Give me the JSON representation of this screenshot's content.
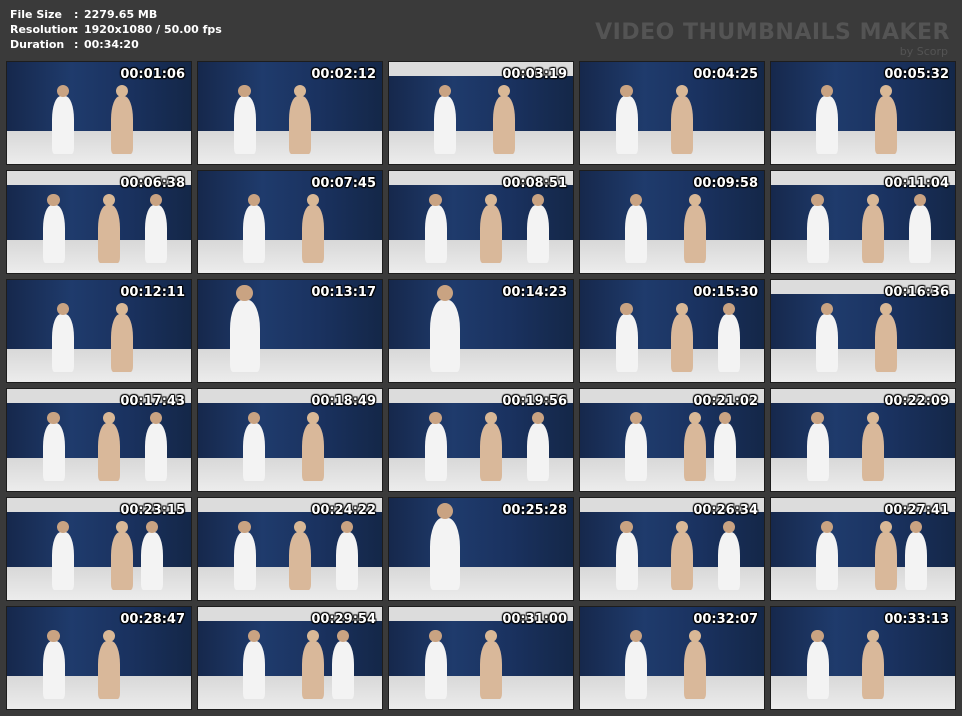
{
  "info": {
    "file_size_label": "File Size",
    "file_size_value": "2279.65 MB",
    "resolution_label": "Resolution",
    "resolution_value": "1920x1080 / 50.00 fps",
    "duration_label": "Duration",
    "duration_value": "00:34:20",
    "separator": ":"
  },
  "brand": {
    "title": "VIDEO THUMBNAILS MAKER",
    "subtitle": "by Scorp"
  },
  "thumbnails": [
    {
      "time": "00:01:06",
      "ceiling": false,
      "people": 2
    },
    {
      "time": "00:02:12",
      "ceiling": false,
      "people": 2
    },
    {
      "time": "00:03:19",
      "ceiling": true,
      "people": 2
    },
    {
      "time": "00:04:25",
      "ceiling": false,
      "people": 2
    },
    {
      "time": "00:05:32",
      "ceiling": false,
      "people": 2
    },
    {
      "time": "00:06:38",
      "ceiling": true,
      "people": 3
    },
    {
      "time": "00:07:45",
      "ceiling": false,
      "people": 2
    },
    {
      "time": "00:08:51",
      "ceiling": true,
      "people": 3
    },
    {
      "time": "00:09:58",
      "ceiling": false,
      "people": 2
    },
    {
      "time": "00:11:04",
      "ceiling": true,
      "people": 3
    },
    {
      "time": "00:12:11",
      "ceiling": false,
      "people": 2
    },
    {
      "time": "00:13:17",
      "ceiling": false,
      "people": 1
    },
    {
      "time": "00:14:23",
      "ceiling": false,
      "people": 1
    },
    {
      "time": "00:15:30",
      "ceiling": false,
      "people": 3
    },
    {
      "time": "00:16:36",
      "ceiling": true,
      "people": 2
    },
    {
      "time": "00:17:43",
      "ceiling": true,
      "people": 3
    },
    {
      "time": "00:18:49",
      "ceiling": true,
      "people": 2
    },
    {
      "time": "00:19:56",
      "ceiling": true,
      "people": 3
    },
    {
      "time": "00:21:02",
      "ceiling": true,
      "people": 3
    },
    {
      "time": "00:22:09",
      "ceiling": true,
      "people": 2
    },
    {
      "time": "00:23:15",
      "ceiling": true,
      "people": 3
    },
    {
      "time": "00:24:22",
      "ceiling": true,
      "people": 3
    },
    {
      "time": "00:25:28",
      "ceiling": false,
      "people": 1
    },
    {
      "time": "00:26:34",
      "ceiling": true,
      "people": 3
    },
    {
      "time": "00:27:41",
      "ceiling": true,
      "people": 3
    },
    {
      "time": "00:28:47",
      "ceiling": false,
      "people": 2
    },
    {
      "time": "00:29:54",
      "ceiling": true,
      "people": 3
    },
    {
      "time": "00:31:00",
      "ceiling": true,
      "people": 2
    },
    {
      "time": "00:32:07",
      "ceiling": false,
      "people": 2
    },
    {
      "time": "00:33:13",
      "ceiling": false,
      "people": 2
    }
  ]
}
